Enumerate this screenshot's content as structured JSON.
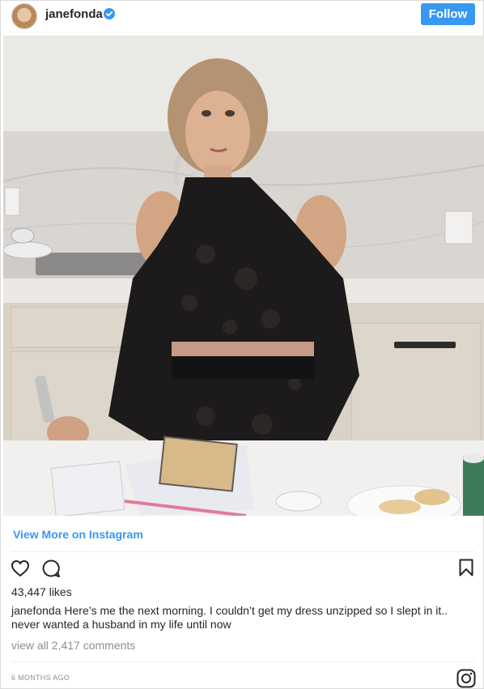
{
  "header": {
    "username": "janefonda",
    "verified_icon": "verified-badge-icon",
    "follow_label": "Follow",
    "accent_color": "#3897f0"
  },
  "photo": {
    "alt": "Woman in a black lace off-shoulder dress standing at a kitchen counter holding a knife"
  },
  "links": {
    "view_more": "View More on Instagram"
  },
  "actions": {
    "like_icon": "heart-icon",
    "comment_icon": "comment-icon",
    "save_icon": "bookmark-icon"
  },
  "stats": {
    "likes": "43,447 likes"
  },
  "caption": {
    "username": "janefonda",
    "text": " Here’s me the next morning. I couldn’t get my dress unzipped so I slept in it.. never wanted a husband in my life until now"
  },
  "comments": {
    "view_all": "view all 2,417 comments"
  },
  "footer": {
    "timestamp": "6 MONTHS AGO",
    "logo_icon": "instagram-icon"
  }
}
